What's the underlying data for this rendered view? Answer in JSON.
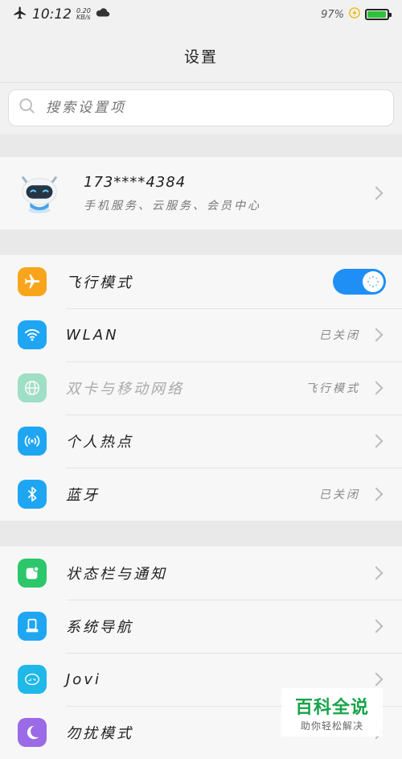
{
  "status_bar": {
    "time": "10:12",
    "net_speed_top": "0.20",
    "net_speed_bottom": "KB/s",
    "battery_percent": "97%",
    "battery_level": 0.97,
    "icons": [
      "airplane-icon",
      "cloud-icon",
      "charging-icon",
      "battery-icon"
    ]
  },
  "header": {
    "title": "设置"
  },
  "search": {
    "placeholder": "搜索设置项"
  },
  "account": {
    "number": "173****4384",
    "subtitle": "手机服务、云服务、会员中心"
  },
  "group1": [
    {
      "label": "飞行模式",
      "icon": "airplane-icon",
      "color": "#f9a51c",
      "toggle": true
    },
    {
      "label": "WLAN",
      "icon": "wifi-icon",
      "color": "#1fa6f2",
      "value": "已关闭"
    },
    {
      "label": "双卡与移动网络",
      "icon": "globe-icon",
      "color": "#35c48a",
      "value": "飞行模式",
      "disabled": true
    },
    {
      "label": "个人热点",
      "icon": "hotspot-icon",
      "color": "#1fa6f2"
    },
    {
      "label": "蓝牙",
      "icon": "bluetooth-icon",
      "color": "#1fa6f2",
      "value": "已关闭"
    }
  ],
  "group2": [
    {
      "label": "状态栏与通知",
      "icon": "notification-icon",
      "color": "#2cc76b"
    },
    {
      "label": "系统导航",
      "icon": "navigation-icon",
      "color": "#1fa6f2"
    },
    {
      "label": "Jovi",
      "icon": "jovi-icon",
      "color": "#1fb8e8"
    },
    {
      "label": "勿扰模式",
      "icon": "moon-icon",
      "color": "#9b6ae6"
    }
  ],
  "watermark": {
    "title": "百科全说",
    "subtitle": "助你轻松解决"
  },
  "colors": {
    "accent": "#1f8ff5",
    "background": "#f1f1f1",
    "row_bg": "#f7f7f7"
  }
}
